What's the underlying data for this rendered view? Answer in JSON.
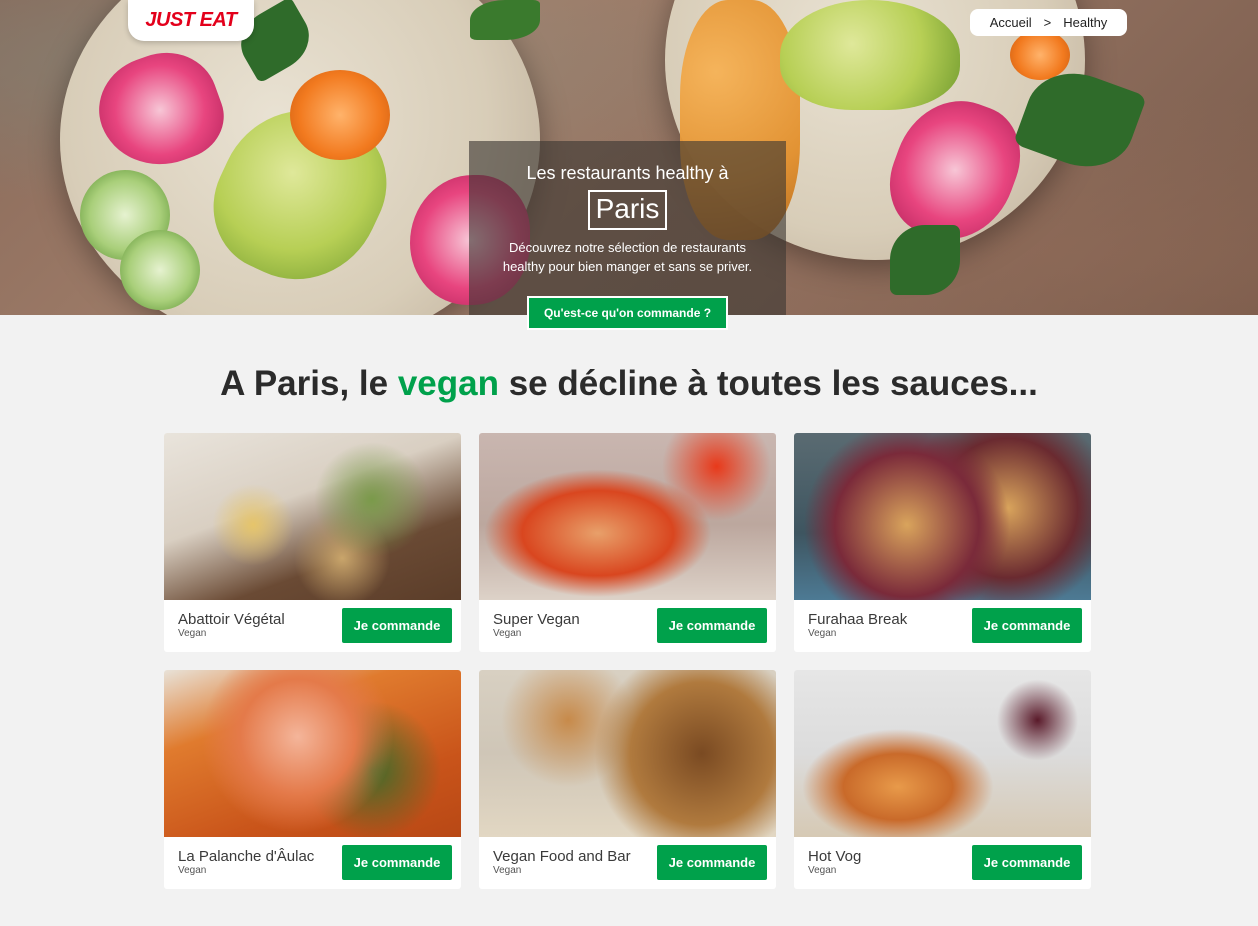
{
  "brand": {
    "logo_text": "JUST EAT",
    "accent_color": "#00a14b",
    "logo_color": "#e3001b"
  },
  "breadcrumb": {
    "home": "Accueil",
    "separator": ">",
    "current": "Healthy"
  },
  "hero": {
    "title": "Les restaurants healthy à",
    "city": "Paris",
    "description": "Découvrez notre sélection de restaurants healthy pour bien manger et sans se priver.",
    "cta_label": "Qu'est-ce qu'on commande ?"
  },
  "section": {
    "title_before": "A Paris, le ",
    "title_accent": "vegan",
    "title_after": " se décline à toutes les sauces..."
  },
  "restaurants": [
    {
      "name": "Abattoir Végétal",
      "category": "Vegan",
      "button": "Je commande"
    },
    {
      "name": "Super Vegan",
      "category": "Vegan",
      "button": "Je commande"
    },
    {
      "name": "Furahaa Break",
      "category": "Vegan",
      "button": "Je commande"
    },
    {
      "name": "La Palanche d'Âulac",
      "category": "Vegan",
      "button": "Je commande"
    },
    {
      "name": "Vegan Food and Bar",
      "category": "Vegan",
      "button": "Je commande"
    },
    {
      "name": "Hot Vog",
      "category": "Vegan",
      "button": "Je commande"
    }
  ]
}
